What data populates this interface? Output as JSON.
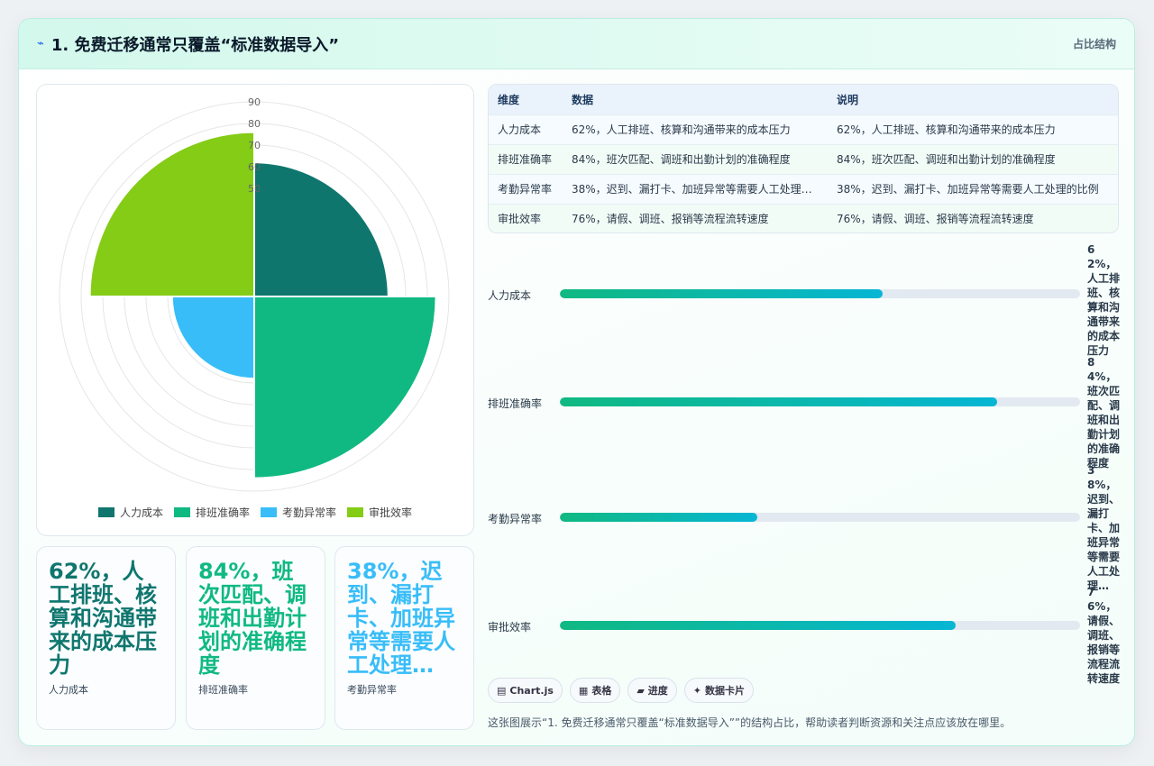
{
  "header": {
    "title": "1. 免费迁移通常只覆盖“标准数据导入”",
    "tag": "占比结构"
  },
  "chart_data": {
    "type": "polarArea",
    "categories": [
      "人力成本",
      "排班准确率",
      "考勤异常率",
      "审批效率"
    ],
    "values": [
      62,
      84,
      38,
      76
    ],
    "colors": [
      "#0f766e",
      "#10b981",
      "#38bdf8",
      "#84cc16"
    ],
    "r_ticks": [
      "",
      "",
      "",
      "",
      "50",
      "60",
      "70",
      "80",
      "90"
    ],
    "rlim": [
      0,
      90
    ],
    "legend_position": "bottom"
  },
  "kpis": [
    {
      "value": "62%，人工排班、核算和沟通带来的成本压力",
      "label": "人力成本",
      "color": "#0f766e"
    },
    {
      "value": "84%，班次匹配、调班和出勤计划的准确程度",
      "label": "排班准确率",
      "color": "#10b981"
    },
    {
      "value": "38%，迟到、漏打卡、加班异常等需要人工处理…",
      "label": "考勤异常率",
      "color": "#38bdf8"
    }
  ],
  "table": {
    "headers": [
      "维度",
      "数据",
      "说明"
    ],
    "rows": [
      [
        "人力成本",
        "62%，人工排班、核算和沟通带来的成本压力",
        "62%，人工排班、核算和沟通带来的成本压力"
      ],
      [
        "排班准确率",
        "84%，班次匹配、调班和出勤计划的准确程度",
        "84%，班次匹配、调班和出勤计划的准确程度"
      ],
      [
        "考勤异常率",
        "38%，迟到、漏打卡、加班异常等需要人工处理…",
        "38%，迟到、漏打卡、加班异常等需要人工处理的比例"
      ],
      [
        "审批效率",
        "76%，请假、调班、报销等流程流转速度",
        "76%，请假、调班、报销等流程流转速度"
      ]
    ]
  },
  "progress": [
    {
      "label": "人力成本",
      "percent": 62,
      "text": "62%，人工排班、核算和沟通带来的成本压力"
    },
    {
      "label": "排班准确率",
      "percent": 84,
      "text": "84%，班次匹配、调班和出勤计划的准确程度"
    },
    {
      "label": "考勤异常率",
      "percent": 38,
      "text": "38%，迟到、漏打卡、加班异常等需要人工处理…"
    },
    {
      "label": "审批效率",
      "percent": 76,
      "text": "76%，请假、调班、报销等流程流转速度"
    }
  ],
  "chips": [
    {
      "icon": "▤",
      "label": "Chart.js"
    },
    {
      "icon": "▦",
      "label": "表格"
    },
    {
      "icon": "▰",
      "label": "进度"
    },
    {
      "icon": "✦",
      "label": "数据卡片"
    }
  ],
  "note": "这张图展示“1. 免费迁移通常只覆盖“标准数据导入””的结构占比，帮助读者判断资源和关注点应该放在哪里。"
}
